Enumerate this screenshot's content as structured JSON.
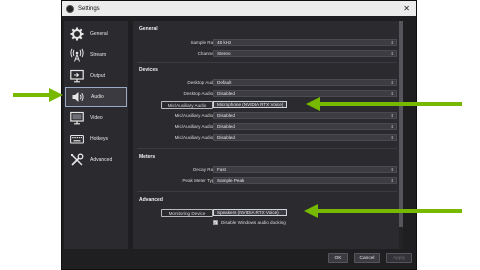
{
  "window": {
    "title": "Settings",
    "close_glyph": "✕"
  },
  "sidebar": {
    "items": [
      {
        "label": "General",
        "icon": "gear-icon",
        "active": false
      },
      {
        "label": "Stream",
        "icon": "broadcast-antenna-icon",
        "active": false
      },
      {
        "label": "Output",
        "icon": "monitor-output-icon",
        "active": false
      },
      {
        "label": "Audio",
        "icon": "speaker-icon",
        "active": true
      },
      {
        "label": "Video",
        "icon": "display-icon",
        "active": false
      },
      {
        "label": "Hotkeys",
        "icon": "keyboard-icon",
        "active": false
      },
      {
        "label": "Advanced",
        "icon": "tools-icon",
        "active": false
      }
    ]
  },
  "general": {
    "title": "General",
    "sample_rate": {
      "label": "Sample Rate",
      "value": "48 kHz"
    },
    "channels": {
      "label": "Channels",
      "value": "Stereo"
    }
  },
  "devices": {
    "title": "Devices",
    "rows": [
      {
        "label": "Desktop Audio",
        "value": "Default"
      },
      {
        "label": "Desktop Audio 2",
        "value": "Disabled"
      },
      {
        "label": "Mic/Auxiliary Audio",
        "value": "Microphone (NVIDIA RTX Voice)"
      },
      {
        "label": "Mic/Auxiliary Audio 2",
        "value": "Disabled"
      },
      {
        "label": "Mic/Auxiliary Audio 3",
        "value": "Disabled"
      },
      {
        "label": "Mic/Auxiliary Audio 4",
        "value": "Disabled"
      }
    ]
  },
  "meters": {
    "title": "Meters",
    "decay_rate": {
      "label": "Decay Rate",
      "value": "Fast"
    },
    "peak_meter_type": {
      "label": "Peak Meter Type",
      "value": "Sample Peak"
    }
  },
  "advanced": {
    "title": "Advanced",
    "monitoring_device": {
      "label": "Monitoring Device",
      "value": "Speakers (NVIDIA RTX Voice)"
    },
    "ducking": {
      "label": "Disable Windows audio ducking",
      "checked": true
    }
  },
  "footer": {
    "ok": "OK",
    "cancel": "Cancel",
    "apply": "Apply"
  },
  "colors": {
    "arrow": "#76b900",
    "highlight_border": "#cfd3da"
  }
}
